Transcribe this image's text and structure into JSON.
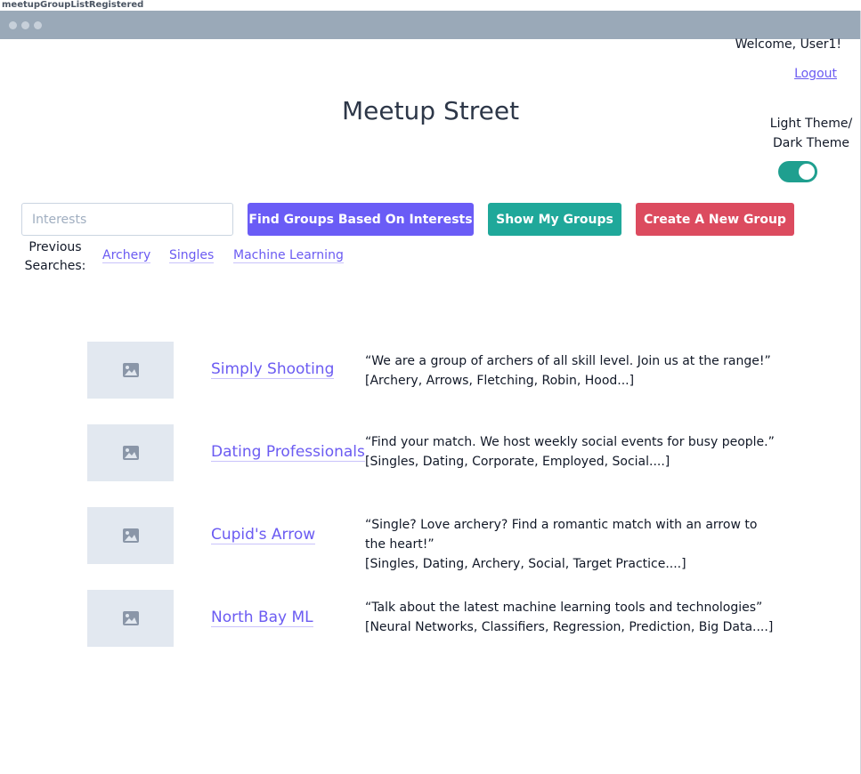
{
  "frame_label": "meetupGroupListRegistered",
  "header": {
    "welcome": "Welcome, User1!",
    "logout": "Logout",
    "title": "Meetup Street",
    "theme_line1": "Light Theme/",
    "theme_line2": "Dark Theme",
    "theme_toggle_on": true
  },
  "search": {
    "placeholder": "Interests",
    "find_label": "Find Groups Based On Interests",
    "my_groups_label": "Show My Groups",
    "create_label": "Create  A New Group",
    "previous_label_1": "Previous",
    "previous_label_2": "Searches:",
    "previous": [
      "Archery",
      "Singles",
      "Machine Learning"
    ]
  },
  "groups": [
    {
      "name": "Simply Shooting",
      "desc1": "“We are a group of archers of all skill level. Join us at the range!”",
      "desc2": "[Archery, Arrows, Fletching, Robin, Hood...]"
    },
    {
      "name": "Dating Professionals",
      "desc1": "“Find your match. We host weekly social events for busy people.”",
      "desc2": "[Singles, Dating, Corporate, Employed, Social....]"
    },
    {
      "name": "Cupid's Arrow",
      "desc1": "“Single? Love archery? Find a romantic match with an arrow to the heart!”",
      "desc2": "[Singles, Dating, Archery,  Social, Target Practice....]"
    },
    {
      "name": "North Bay ML",
      "desc1": "“Talk about the latest machine learning tools and technologies”",
      "desc2": "[Neural Networks, Classifiers, Regression, Prediction, Big Data....]"
    }
  ],
  "colors": {
    "accent_purple": "#6a5cf6",
    "accent_teal": "#1fa89a",
    "accent_red": "#dc4b5f"
  },
  "icons": {
    "thumbnail": "image-placeholder-icon"
  }
}
